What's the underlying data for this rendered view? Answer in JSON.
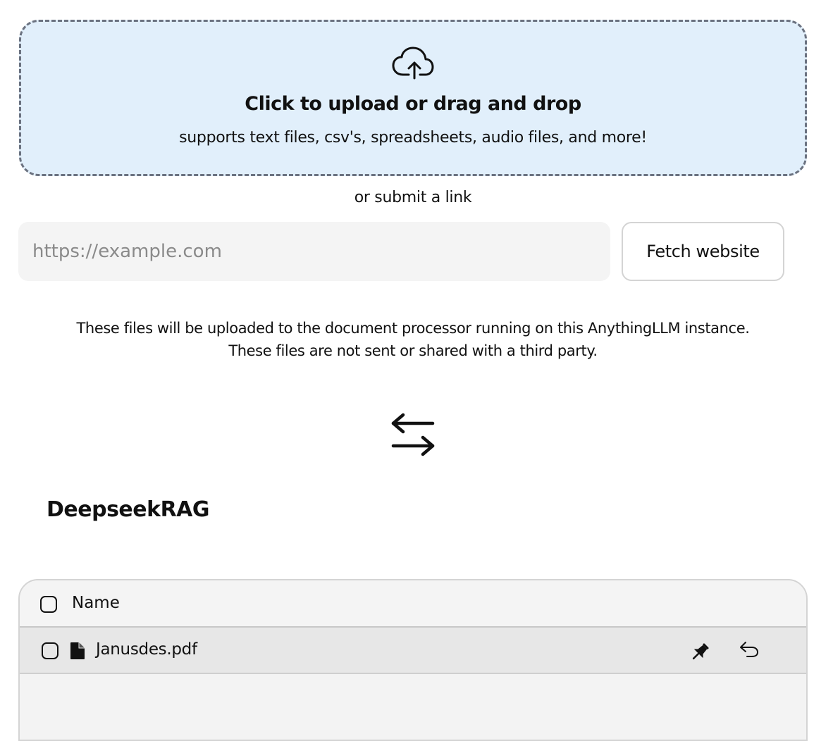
{
  "upload": {
    "icon": "cloud-upload-icon",
    "title": "Click to upload or drag and drop",
    "subtitle": "supports text files, csv's, spreadsheets, audio files, and more!"
  },
  "link": {
    "or_text": "or submit a link",
    "placeholder": "https://example.com",
    "value": "",
    "button_label": "Fetch website"
  },
  "notice": {
    "line1": "These files will be uploaded to the document processor running on this AnythingLLM instance.",
    "line2": "These files are not sent or shared with a third party."
  },
  "swap": {
    "icon": "arrows-left-right-icon"
  },
  "workspace": {
    "name": "DeepseekRAG",
    "table": {
      "header": {
        "name_label": "Name",
        "select_all_checked": false
      },
      "rows": [
        {
          "name": "Janusdes.pdf",
          "icon": "file-icon",
          "checked": false,
          "actions": [
            "pin-icon",
            "undo-icon"
          ]
        }
      ]
    }
  },
  "colors": {
    "dropzone_bg": "#e1effb",
    "dropzone_border": "#6b7280",
    "input_bg": "#f4f4f4",
    "row_bg": "#e7e7e7"
  }
}
